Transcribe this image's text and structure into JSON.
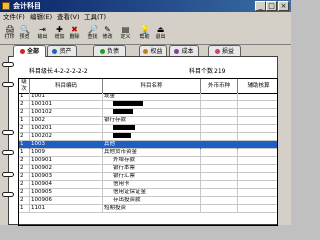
{
  "window": {
    "title": "会计科目"
  },
  "menu": {
    "file": "文件(F)",
    "edit": "编辑(E)",
    "view": "查看(V)",
    "tools": "工具(T)"
  },
  "toolbar": [
    {
      "label": "打印",
      "icon": "print-icon"
    },
    {
      "label": "预览",
      "icon": "preview-icon"
    },
    {
      "label": "输出",
      "icon": "export-icon"
    },
    {
      "label": "增加",
      "icon": "add-icon"
    },
    {
      "label": "删除",
      "icon": "delete-icon"
    },
    {
      "label": "查找",
      "icon": "find-icon"
    },
    {
      "label": "修改",
      "icon": "edit-icon"
    },
    {
      "label": "定义",
      "icon": "define-icon"
    },
    {
      "label": "帮助",
      "icon": "help-icon"
    },
    {
      "label": "退出",
      "icon": "exit-icon"
    }
  ],
  "tabs": [
    {
      "label": "全部",
      "color": "#d02020"
    },
    {
      "label": "资产",
      "color": "#2060c0"
    },
    {
      "label": "负债",
      "color": "#20a020"
    },
    {
      "label": "权益",
      "color": "#c08020"
    },
    {
      "label": "成本",
      "color": "#8040a0"
    },
    {
      "label": "损益",
      "color": "#d04080"
    }
  ],
  "info": {
    "code_length_label": "科目级长",
    "code_length_value": "4-2-2-2-2-2",
    "count_label": "科目个数",
    "count_value": "219"
  },
  "table": {
    "headers": [
      "级次",
      "科目编码",
      "科目名称",
      "外币币种",
      "辅助核算"
    ],
    "rows": [
      {
        "level": "1",
        "code": "1001",
        "name": "现金"
      },
      {
        "level": "2",
        "code": "100101",
        "name": ""
      },
      {
        "level": "2",
        "code": "100102",
        "name": ""
      },
      {
        "level": "1",
        "code": "1002",
        "name": "银行存款"
      },
      {
        "level": "2",
        "code": "100201",
        "name": ""
      },
      {
        "level": "2",
        "code": "100202",
        "name": ""
      },
      {
        "level": "1",
        "code": "1003",
        "name": "其他",
        "selected": true
      },
      {
        "level": "1",
        "code": "1009",
        "name": "其他货币资金"
      },
      {
        "level": "2",
        "code": "100901",
        "name": "外埠存款"
      },
      {
        "level": "2",
        "code": "100902",
        "name": "银行本票"
      },
      {
        "level": "2",
        "code": "100903",
        "name": "银行汇票"
      },
      {
        "level": "2",
        "code": "100904",
        "name": "信用卡"
      },
      {
        "level": "2",
        "code": "100905",
        "name": "信用证保证金"
      },
      {
        "level": "2",
        "code": "100906",
        "name": "存出投资款"
      },
      {
        "level": "1",
        "code": "1101",
        "name": "短期投资"
      }
    ]
  }
}
